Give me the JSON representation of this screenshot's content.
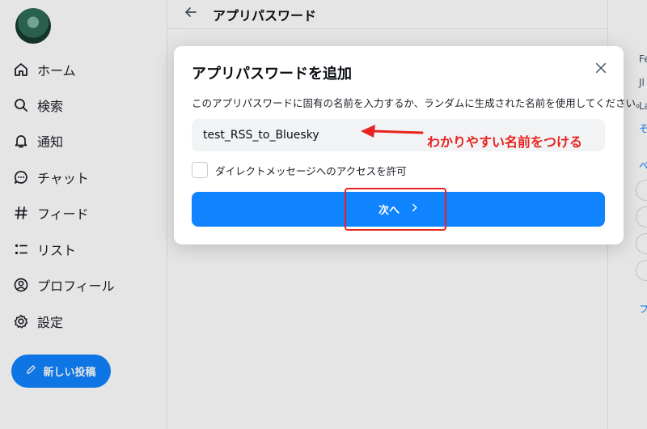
{
  "sidebar": {
    "items": [
      {
        "label": "ホーム",
        "icon": "home-icon"
      },
      {
        "label": "検索",
        "icon": "search-icon"
      },
      {
        "label": "通知",
        "icon": "bell-icon"
      },
      {
        "label": "チャット",
        "icon": "chat-icon"
      },
      {
        "label": "フィード",
        "icon": "hash-icon"
      },
      {
        "label": "リスト",
        "icon": "list-icon"
      },
      {
        "label": "プロフィール",
        "icon": "profile-icon"
      },
      {
        "label": "設定",
        "icon": "gear-icon"
      }
    ],
    "new_post_label": "新しい投稿"
  },
  "main": {
    "back_icon": "arrow-left-icon",
    "title": "アプリパスワード"
  },
  "right_col": {
    "texts": [
      "Fe",
      "Jl",
      "La"
    ],
    "links": [
      "そ",
      "ペ",
      "フ"
    ]
  },
  "dialog": {
    "title": "アプリパスワードを追加",
    "description": "このアプリパスワードに固有の名前を入力するか、ランダムに生成された名前を使用してください。",
    "input_value": "test_RSS_to_Bluesky",
    "checkbox_label": "ダイレクトメッセージへのアクセスを許可",
    "checkbox_checked": false,
    "next_label": "次へ",
    "next_icon": "chevron-right-icon",
    "close_icon": "close-icon"
  },
  "annotation": {
    "note": "わかりやすい名前をつける",
    "color": "#e8231f"
  },
  "colors": {
    "accent": "#1083fe",
    "annotation_red": "#e8231f"
  }
}
